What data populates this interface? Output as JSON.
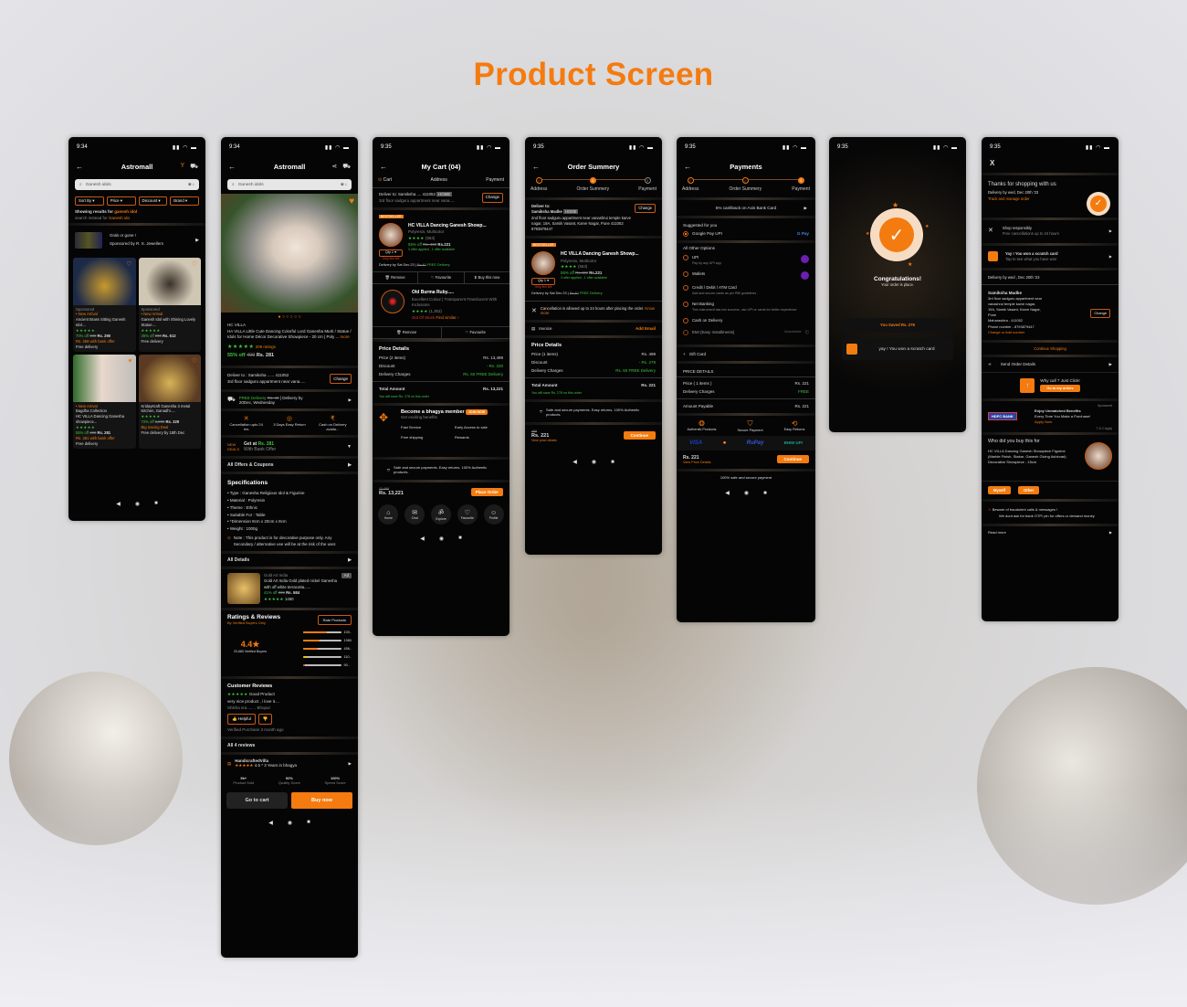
{
  "page_title": "Product Screen",
  "colors": {
    "accent": "#f47b0f",
    "success": "#3ec43e",
    "danger": "#e23b2e",
    "screen_bg": "#050505"
  },
  "listing": {
    "time": "9:34",
    "title": "Astromall",
    "search_placeholder": "Ganesh idols",
    "filters": [
      "Sort By",
      "Price",
      "Discount",
      "Brand"
    ],
    "results_prefix": "Showing results for ",
    "results_term": "ganesh idol",
    "instead_prefix": "search instead for ",
    "instead_term": "Ganesh ido",
    "sponsor": {
      "headline": "Grab or gone !",
      "sub": "Sponsored by R. S. Jewellers"
    },
    "products": [
      {
        "tag": "Sponsored",
        "badge": "New Arrival",
        "name": "Ancient Brass Sitting Ganesh Idol....",
        "discount": "70% off",
        "mrp": "900",
        "price": "Rs. 290",
        "offer": "Rs. 258 with bank offer",
        "delivery": "Free delivery"
      },
      {
        "tag": "Sponsored",
        "badge": "New Arrival",
        "name": "Ganesh Idol with Shining Lovely Statue....",
        "discount": "35% off",
        "mrp": "900",
        "price": "Rs. 612",
        "offer": "",
        "delivery": "Free delivery"
      },
      {
        "tag": "",
        "badge": "New Arrival",
        "name": "Bagdha Collection",
        "desc": "HC VILLA Dancing Ganesha showpiece...",
        "discount": "55% off",
        "mrp": "499",
        "price": "Rs. 281",
        "offer": "Rs. 281 with bank offer",
        "delivery": "Free delivery"
      },
      {
        "tag": "",
        "badge": "",
        "name": "KridayKraft Ganesha 3 metal Kitchen, Ganadhi.....",
        "discount": "72% off",
        "mrp": "1,200",
        "price": "Rs. 329",
        "offer": "Big Saving Deal",
        "delivery": "Free delivery by 18th Dec"
      }
    ]
  },
  "detail": {
    "time": "9:34",
    "title": "Astromall",
    "search_placeholder": "Ganesh idols",
    "brand": "HC VILLA",
    "name": "HA VILLA Little Cute Dancing Colorful Lord Ganesha Murti / Statue / Idols for Home Décor Decorative Showpiece - 20 cm | Poly ...",
    "more": "more",
    "ratings": "209 ratings",
    "discount": "55% off",
    "mrp": "499",
    "price": "Rs. 281",
    "deliver_to": "Deliver to : Samiksha ...... 411052",
    "address": "3rd floor sadguru appartment near vana.....",
    "change": "Change",
    "free_delivery": "FREE Delivery",
    "delivery_strike": "Rs. 40",
    "delivery_by": "| Delivery by",
    "delivery_date": "20Dec, Wednesday",
    "features": [
      "Cancellation upto 24 hrs",
      "3 Days Easy Return",
      "Cash on Delivery availa..."
    ],
    "get_at": "Get at",
    "get_price": "Rs. 281",
    "bank_offer": "With Bank Offer",
    "all_offers": "All Offers & Coupons",
    "spec_title": "Specifications",
    "specs": [
      "Type : Ganesha Religious Idol & Figurine",
      "Material : Polyresin",
      "Theme : Ethnic",
      "Suitable For : Table",
      "*Dimension 8cm x 20cm x 8cm",
      "Weight : 1000g"
    ],
    "note": "Note : This product is for decorative purpose only. Any Secondary / alternative use will be at the risk of the user.",
    "all_details": "All Details",
    "similar": {
      "brand": "Gold Art India",
      "name": "Gold Art India Gold plated nickel Ganesha with off white terracotta......",
      "discount": "41% off",
      "mrp": "999",
      "price": "Rs. 584",
      "count": "1450",
      "tag": "Ad"
    },
    "ratings_title": "Ratings & Reviews",
    "verified_only": "By Verified Buyers Only",
    "rate_btn": "Rate Products",
    "avg": "4.4",
    "buyers": "20,680 Verified Buyers",
    "dist": [
      {
        "label": "100..",
        "pct": 0.62,
        "color": "#f47b0f"
      },
      {
        "label": "1980",
        "pct": 0.45,
        "color": "#f47b0f"
      },
      {
        "label": "456..",
        "pct": 0.38,
        "color": "#f47b0f"
      },
      {
        "label": "110..",
        "pct": 0.12,
        "color": "#e6c619"
      },
      {
        "label": "90..",
        "pct": 0.06,
        "color": "#e23b2e"
      }
    ],
    "customer_reviews": "Customer Reviews",
    "review_head": "Good Product",
    "review_text": "very nice product , i love it....",
    "reviewer": "Shikha sra...... , Bhopur",
    "helpful": "Helpful",
    "verified": "Verified Purchase  3 month ago",
    "all_reviews": "All 4 reviews",
    "seller": "HandicraftedVilla",
    "seller_rating": "4.5",
    "seller_years": "* 3 Years in bhagya",
    "seller_stats": [
      {
        "v": "9k+",
        "l": "Product Sold"
      },
      {
        "v": "92%",
        "l": "Quality Score"
      },
      {
        "v": "100%",
        "l": "Speed Score"
      }
    ],
    "go_cart": "Go to cart",
    "buy_now": "Buy now"
  },
  "cart": {
    "time": "9:35",
    "title": "My Cart  (04)",
    "steps": [
      "Cart",
      "Address",
      "Payment"
    ],
    "deliver": "Deliver to: Samiksha .... 411052",
    "home": "HOME",
    "address": "3rd floor sadguru appartment near vana.....",
    "change": "Change",
    "items": [
      {
        "badge": "BESTSELLER",
        "name": "HC VILLA Dancing Ganesh Showp...",
        "meta": "Polyresin, Multicolor",
        "reviews": "(553)",
        "qty": "Qty 1",
        "only": "Only few left",
        "discount": "55% off",
        "mrp": "Rs. 499",
        "price": "Rs.221",
        "offers": "3 offer applied , 1 offer available",
        "delivery": "Delivery by Sat Dec 23",
        "delivery_strike": "Rs.40",
        "free": "FREE Delivery",
        "actions": [
          "Remove",
          "Favourite",
          "Buy this now"
        ]
      },
      {
        "badge": "",
        "name": "Old Burma Ruby.....",
        "meta": "Excellent Colour | Transparent-Translucent With Inclusions",
        "reviews": "(1,353)",
        "stock": "Out Of Stock",
        "similar": "Find similar",
        "actions": [
          "Remove",
          "Favourite"
        ]
      }
    ],
    "price_title": "Price Details",
    "rows": [
      {
        "l": "Price (2 items)",
        "v": "Rs. 13,499",
        "c": ""
      },
      {
        "l": "Discount",
        "v": "- Rs. 220",
        "c": "green"
      },
      {
        "l": "Delivery Charges",
        "v": "Rs. 60  FREE Delivery",
        "c": "green"
      }
    ],
    "total_l": "Total Amount",
    "total_v": "Rs. 13,221",
    "save": "You will save Rs. 278 on this order",
    "member_title": "Become a bhagya member",
    "member_sub": "Get exciting benefits",
    "join": "JOIN NOW",
    "perks": [
      "Fast Service",
      "Early Access to sale",
      "Free shipping",
      "Rewards"
    ],
    "secure": "Safe and secure payments. Easy returns. 100% Authentic products.",
    "bottom_mrp": "13,499",
    "bottom_total": "Rs. 13,221",
    "place": "Place Order",
    "tabs": [
      "Home",
      "Chat",
      "Explore",
      "Favourite",
      "Profile"
    ]
  },
  "summary": {
    "time": "9:35",
    "title": "Order Summery",
    "steps": [
      "Address",
      "Order Summery",
      "Payment"
    ],
    "deliver": "Deliver to:",
    "name": "Samiksha Madke",
    "home": "HOME",
    "change": "Change",
    "address": "2nd floor sadguru appartment near vanashrui temple karve nagar, 19A, Sarsik Vasant, Karve Nagar, Pune 411052",
    "phone": "8793879447",
    "item": {
      "badge": "BESTSELLER",
      "name": "HC VILLA Dancing Ganesh Showp...",
      "meta": "Polyresin, Multicolor",
      "reviews": "(553)",
      "qty": "Qty 1",
      "only": "Only few left",
      "discount": "55% off",
      "mrp": "Rs.499",
      "price": "Rs.221",
      "offers": "3 offer applied , 1 offer available",
      "delivery": "Delivery by Sat Dec 23",
      "strike": "Rs.40",
      "free": "FREE Delivery"
    },
    "cancel": "Cancellation is allowed up to 24 hours after placing the order.",
    "know": "Know more",
    "invoice": "Invoice",
    "add_email": "Add Email",
    "price_title": "Price Details",
    "rows": [
      {
        "l": "Price (1 items)",
        "v": "Rs. 499",
        "c": ""
      },
      {
        "l": "Discount",
        "v": "- Rs. 278",
        "c": "green"
      },
      {
        "l": "Delivery Charges",
        "v": "Rs. 60  FREE Delivery",
        "c": "green"
      }
    ],
    "total_l": "Total Amount",
    "total_v": "Rs. 221",
    "save": "You will save Rs. 278 on this order",
    "secure": "Safe and secure payments. Easy returns. 100% Authentic products.",
    "bottom_mrp": "499",
    "bottom_total": "Rs. 221",
    "view": "View price details",
    "cont": "Continue"
  },
  "payments": {
    "time": "9:35",
    "title": "Payments",
    "steps": [
      "Address",
      "Order Summery",
      "Payment"
    ],
    "cashback": "5% cashback on Axis Bank Card",
    "suggested": "Suggested for you",
    "gpay": "Google Pay UPI",
    "gpay_logo": "G Pay",
    "other": "All Other Options",
    "options": [
      {
        "t": "UPI",
        "s": "Pay by any UPI app",
        "ph": true
      },
      {
        "t": "Wallets",
        "s": "",
        "ph": true
      },
      {
        "t": "Credit / Debit / ATM Card",
        "s": "Add and secure cards as per RBI guidelines",
        "ph": false
      },
      {
        "t": "Net Banking",
        "s": "This instrument has low success, use UPI or cards for better experience",
        "ph": false
      },
      {
        "t": "Cash on Delivery",
        "s": "",
        "ph": false
      },
      {
        "t": "EMI (Easy Installments)",
        "s": "",
        "ph": false,
        "unavail": "Unavailable"
      }
    ],
    "gift": "Gift Card",
    "pd": "PRICE DETAILS",
    "rows": [
      {
        "l": "Price ( 1 items )",
        "v": "Rs. 221",
        "c": ""
      },
      {
        "l": "Delivery Charges",
        "v": "FREE",
        "c": "green"
      }
    ],
    "payable_l": "Amount Payable",
    "payable_v": "Rs. 221",
    "trust": [
      "Authentic Products",
      "Secure Payment",
      "Easy Returns"
    ],
    "cards": [
      "VISA",
      "mastercard",
      "RuPay",
      "BHIM UPI"
    ],
    "bottom_total": "Rs. 221",
    "view": "View Price Details",
    "cont": "Continue",
    "safe": "100% safe and secure payment"
  },
  "success": {
    "time": "9:35",
    "title": "Congratulations!",
    "sub": "Your order is place.",
    "saved": "You Saved Rs. 278",
    "scratch": "yay ! You won a scratch card"
  },
  "thanks": {
    "time": "9:35",
    "close": "X",
    "title": "Thanks for shopping with us",
    "delivery": "Delivery by wed, Dec 20th '23",
    "track": "Track and manage order",
    "shop_t": "Shop responsibly",
    "shop_s": "Free cancellations up to 24 hours",
    "scr_t": "Yay ! You won a scratch card",
    "scr_s": "Tap to see what you have won",
    "delivery2": "Delivery by wed , Dec 20th '23",
    "name": "Samiksha Madke",
    "addr": [
      "3rd floor sadguru appartment near",
      "vanashrui temple karve nagar,",
      "19A, Sarsik Vasant, Karve Nagar,",
      "Pune",
      "Maharashtra - 411052",
      "Phone number - 8793879447"
    ],
    "change": "Change",
    "add_number": "Change or Add number",
    "continue": "Continue Shopping",
    "send": "Send Order Details",
    "why": "Why call ? Just Click!",
    "goto": "Go to my orders",
    "sponsored": "Sponsored",
    "bank": "HDFC BANK",
    "benefit_t": "Enjoy Unmatched Benefits",
    "benefit_s": "Every Time You Make a Purchase!",
    "apply": "Apply Now",
    "tc": "T & C Apply",
    "who": "Who did you buy this for",
    "who_item": "HC VILLA Dancing Ganesh Showpiece Figurine (Marble Finish, Statue, Ganesh Giving Ashirvad) Decorative Showpiece - 15cm",
    "myself": "Myself",
    "other": "Other",
    "beware": "Beware of fraudulent calls & messages !",
    "beware_s": "We dont ask for bank OTP/ pin for offers or demand money",
    "read": "Read more"
  }
}
